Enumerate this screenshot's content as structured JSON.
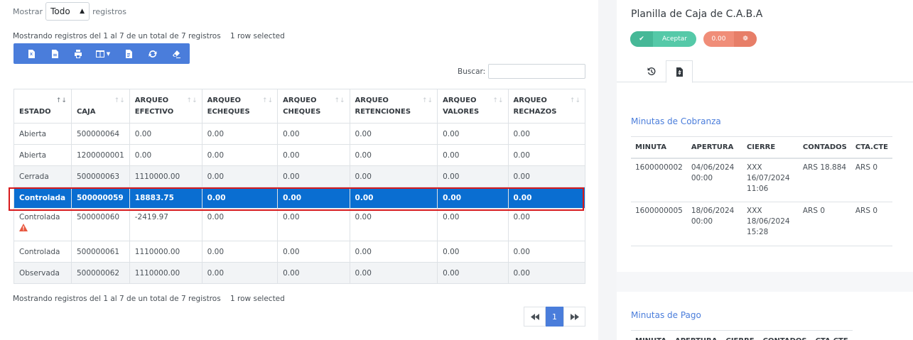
{
  "length_menu": {
    "prefix": "Mostrar",
    "selected": "Todo",
    "suffix": "registros"
  },
  "info": {
    "text": "Mostrando registros del 1 al 7 de un total de 7 registros",
    "selected": "1 row selected"
  },
  "toolbar": {
    "buttons": [
      {
        "name": "excel",
        "icon": "excel-file-icon"
      },
      {
        "name": "csv",
        "icon": "file-icon"
      },
      {
        "name": "print",
        "icon": "print-icon"
      },
      {
        "name": "columns",
        "icon": "columns-icon"
      },
      {
        "name": "pdf",
        "icon": "pdf-file-icon"
      },
      {
        "name": "refresh",
        "icon": "refresh-icon"
      },
      {
        "name": "clear",
        "icon": "eraser-icon"
      }
    ]
  },
  "search": {
    "label": "Buscar:",
    "value": ""
  },
  "table": {
    "headers": [
      [
        "ESTADO"
      ],
      [
        "CAJA"
      ],
      [
        "ARQUEO",
        "EFECTIVO"
      ],
      [
        "ARQUEO",
        "ECHEQUES"
      ],
      [
        "ARQUEO",
        "CHEQUES"
      ],
      [
        "ARQUEO",
        "RETENCIONES"
      ],
      [
        "ARQUEO",
        "VALORES"
      ],
      [
        "ARQUEO",
        "RECHAZOS"
      ]
    ],
    "rows": [
      [
        "Abierta",
        "500000064",
        "0.00",
        "0.00",
        "0.00",
        "0.00",
        "0.00",
        "0.00"
      ],
      [
        "Abierta",
        "1200000001",
        "0.00",
        "0.00",
        "0.00",
        "0.00",
        "0.00",
        "0.00"
      ],
      [
        "Cerrada",
        "500000063",
        "1110000.00",
        "0.00",
        "0.00",
        "0.00",
        "0.00",
        "0.00"
      ],
      [
        "Controlada",
        "500000059",
        "18883.75",
        "0.00",
        "0.00",
        "0.00",
        "0.00",
        "0.00"
      ],
      [
        "Controlada",
        "500000060",
        "-2419.97",
        "0.00",
        "0.00",
        "0.00",
        "0.00",
        "0.00"
      ],
      [
        "Controlada",
        "500000061",
        "1110000.00",
        "0.00",
        "0.00",
        "0.00",
        "0.00",
        "0.00"
      ],
      [
        "Observada",
        "500000062",
        "1110000.00",
        "0.00",
        "0.00",
        "0.00",
        "0.00",
        "0.00"
      ]
    ],
    "selected_row": 3,
    "warning_row": 4
  },
  "pagination": {
    "current": "1"
  },
  "panel": {
    "title": "Planilla de Caja de C.A.B.A",
    "accept_label": "Aceptar",
    "amount_label": "0.00",
    "accent": "#4a7ddb",
    "cobranza": {
      "title": "Minutas de Cobranza",
      "headers": [
        "MINUTA",
        "APERTURA",
        "CIERRE",
        "CONTADOS",
        "CTA.CTE"
      ],
      "rows": [
        {
          "minuta": "1600000002",
          "apertura": [
            "04/06/2024",
            "00:00"
          ],
          "cierre": [
            "XXX",
            "16/07/2024",
            "11:06"
          ],
          "contados": "ARS 18.884",
          "ctacte": "ARS 0"
        },
        {
          "minuta": "1600000005",
          "apertura": [
            "18/06/2024",
            "00:00"
          ],
          "cierre": [
            "XXX",
            "18/06/2024",
            "15:28"
          ],
          "contados": "ARS 0",
          "ctacte": "ARS 0"
        }
      ]
    },
    "pago": {
      "title": "Minutas de Pago",
      "headers": [
        "MINUTA",
        "APERTURA",
        "CIERRE",
        "CONTADOS",
        "CTA.CTE"
      ]
    }
  }
}
